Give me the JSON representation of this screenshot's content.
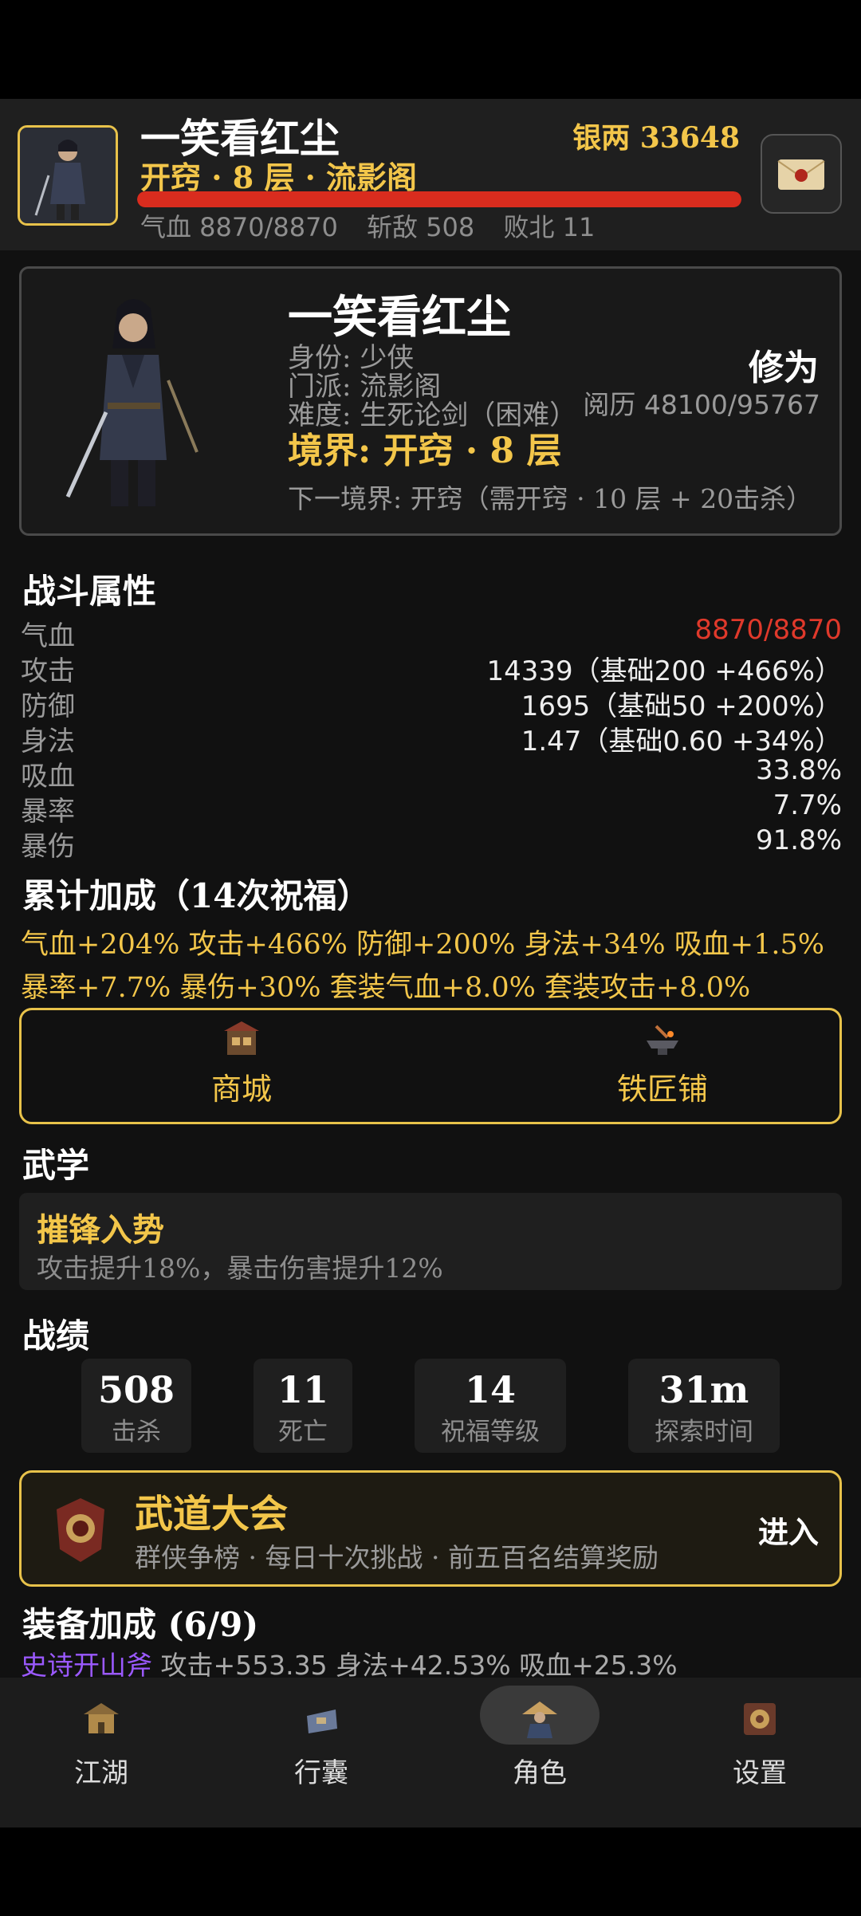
{
  "header": {
    "player_name": "一笑看红尘",
    "silver_label": "银两 33648",
    "realm_line": "开窍 · 8 层 · 流影阁",
    "hp_fraction": 1.0,
    "stats": [
      "气血 8870/8870",
      "斩敌 508",
      "败北 11"
    ]
  },
  "profile": {
    "name": "一笑看红尘",
    "identity": "身份: 少侠",
    "sect": "门派: 流影阁",
    "difficulty": "难度: 生死论剑（困难）",
    "realm": "境界: 开窍 · 8 层",
    "next_realm": "下一境界: 开窍（需开窍 · 10 层 + 20击杀）",
    "cultivation_title": "修为",
    "experience": "阅历 48100/95767"
  },
  "combat": {
    "title": "战斗属性",
    "rows": [
      {
        "label": "气血",
        "value": "8870/8870"
      },
      {
        "label": "攻击",
        "value": "14339（基础200 +466%）"
      },
      {
        "label": "防御",
        "value": "1695（基础50 +200%）"
      },
      {
        "label": "身法",
        "value": "1.47（基础0.60 +34%）"
      },
      {
        "label": "吸血",
        "value": "33.8%"
      },
      {
        "label": "暴率",
        "value": "7.7%"
      },
      {
        "label": "暴伤",
        "value": "91.8%"
      }
    ]
  },
  "bonus": {
    "title": "累计加成（14次祝福）",
    "line1": "气血+204% 攻击+466% 防御+200% 身法+34% 吸血+1.5%",
    "line2": "暴率+7.7% 暴伤+30% 套装气血+8.0% 套装攻击+8.0%"
  },
  "shops": {
    "mall": "商城",
    "smithy": "铁匠铺"
  },
  "martial": {
    "title": "武学",
    "skill_name": "摧锋入势",
    "skill_desc": "攻击提升18%，暴击伤害提升12%"
  },
  "record": {
    "title": "战绩",
    "items": [
      {
        "value": "508",
        "label": "击杀"
      },
      {
        "value": "11",
        "label": "死亡"
      },
      {
        "value": "14",
        "label": "祝福等级"
      },
      {
        "value": "31m",
        "label": "探索时间"
      }
    ]
  },
  "tournament": {
    "title": "武道大会",
    "desc": "群侠争榜 · 每日十次挑战 · 前五百名结算奖励",
    "enter": "进入"
  },
  "equipment": {
    "title": "装备加成 (6/9)",
    "item_name": "史诗开山斧",
    "item_stats": "攻击+553.35 身法+42.53% 吸血+25.3%"
  },
  "nav": {
    "items": [
      "江湖",
      "行囊",
      "角色",
      "设置"
    ],
    "active": "角色"
  },
  "colors": {
    "gold": "#f3c64a",
    "hp_red": "#d92c1e",
    "epic_purple": "#9b59ff"
  }
}
